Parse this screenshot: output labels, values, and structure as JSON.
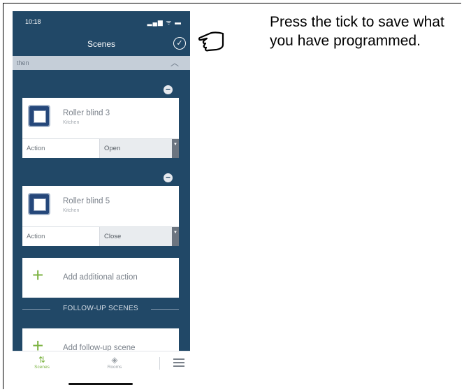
{
  "status_bar": {
    "time": "10:18",
    "icons": "▂▄▆ ᯤ ▬"
  },
  "header": {
    "title": "Scenes",
    "tick_icon": "check-circle-icon"
  },
  "then_bar": {
    "label": "then",
    "icon": "chevron-up-icon"
  },
  "actions": [
    {
      "device": "Roller blind 3",
      "room": "Kitchen",
      "action_label": "Action",
      "action_value": "Open"
    },
    {
      "device": "Roller blind 5",
      "room": "Kitchen",
      "action_label": "Action",
      "action_value": "Close"
    }
  ],
  "add_action": {
    "label": "Add additional action"
  },
  "followup": {
    "heading": "FOLLOW-UP SCENES",
    "add_label": "Add follow-up scene"
  },
  "tabbar": {
    "scenes": "Scenes",
    "rooms": "Rooms"
  },
  "instruction": {
    "text": "Press the tick to save what you have programmed."
  },
  "colors": {
    "app_bg": "#214867",
    "accent": "#7cb342",
    "then_bar": "#c5ced8"
  }
}
